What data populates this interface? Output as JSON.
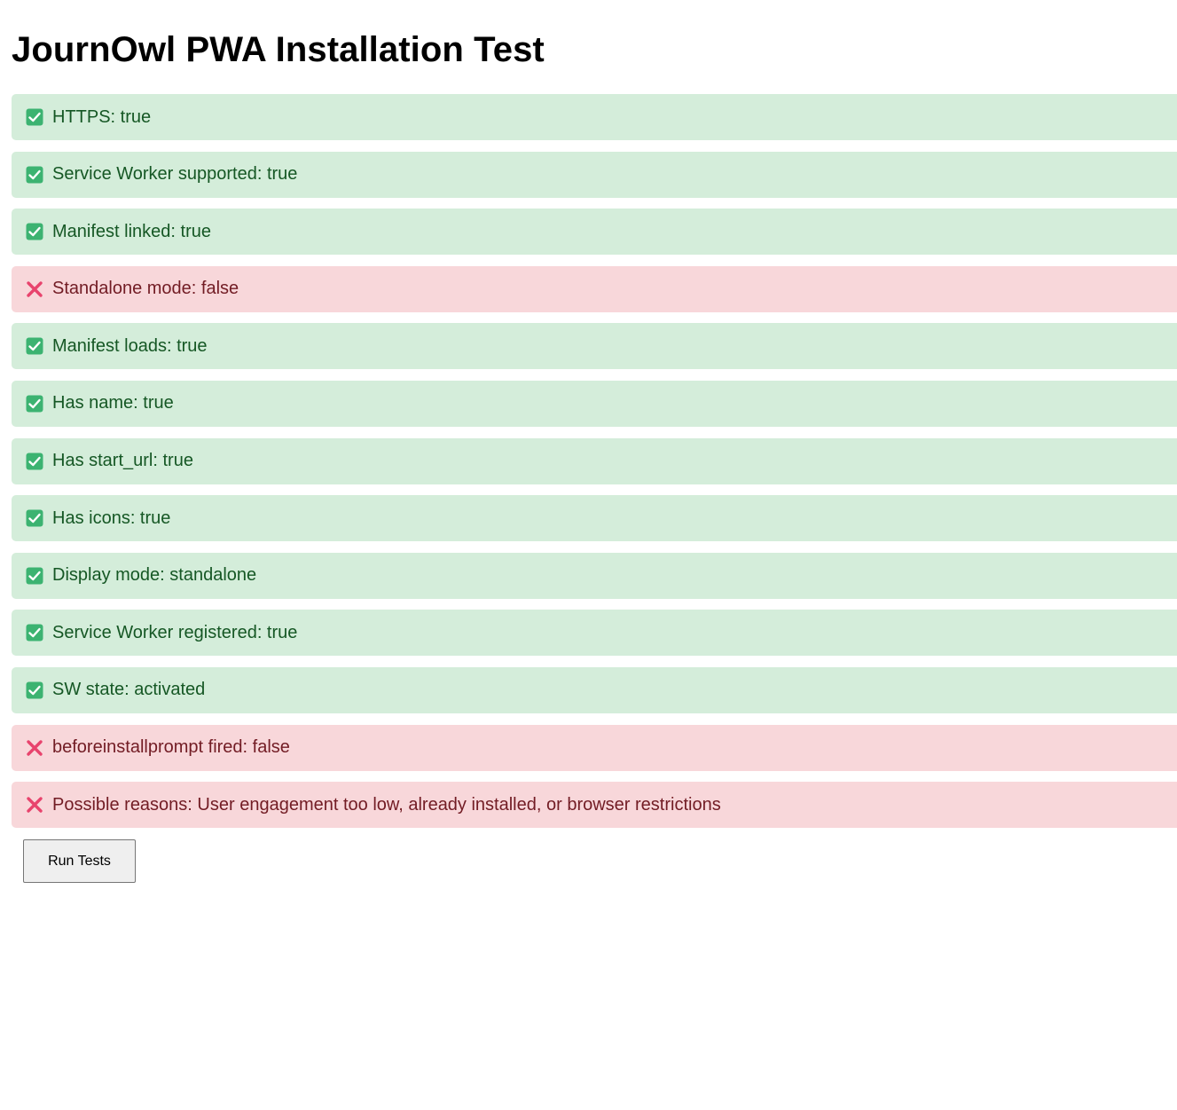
{
  "page": {
    "title": "JournOwl PWA Installation Test"
  },
  "results": [
    {
      "status": "pass",
      "icon": "check-box-icon",
      "text": "HTTPS: true"
    },
    {
      "status": "pass",
      "icon": "check-box-icon",
      "text": "Service Worker supported: true"
    },
    {
      "status": "pass",
      "icon": "check-box-icon",
      "text": "Manifest linked: true"
    },
    {
      "status": "fail",
      "icon": "cross-mark-icon",
      "text": "Standalone mode: false"
    },
    {
      "status": "pass",
      "icon": "check-box-icon",
      "text": "Manifest loads: true"
    },
    {
      "status": "pass",
      "icon": "check-box-icon",
      "text": "Has name: true"
    },
    {
      "status": "pass",
      "icon": "check-box-icon",
      "text": "Has start_url: true"
    },
    {
      "status": "pass",
      "icon": "check-box-icon",
      "text": "Has icons: true"
    },
    {
      "status": "pass",
      "icon": "check-box-icon",
      "text": "Display mode: standalone"
    },
    {
      "status": "pass",
      "icon": "check-box-icon",
      "text": "Service Worker registered: true"
    },
    {
      "status": "pass",
      "icon": "check-box-icon",
      "text": "SW state: activated"
    },
    {
      "status": "fail",
      "icon": "cross-mark-icon",
      "text": "beforeinstallprompt fired: false"
    },
    {
      "status": "fail",
      "icon": "cross-mark-icon",
      "text": "Possible reasons: User engagement too low, already installed, or browser restrictions"
    }
  ],
  "actions": {
    "run_tests_label": "Run Tests"
  },
  "colors": {
    "pass_bg": "#d4edda",
    "pass_text": "#155724",
    "fail_bg": "#f8d7da",
    "fail_text": "#721c24",
    "check_icon": "#3cb371",
    "cross_icon": "#e8436d"
  }
}
